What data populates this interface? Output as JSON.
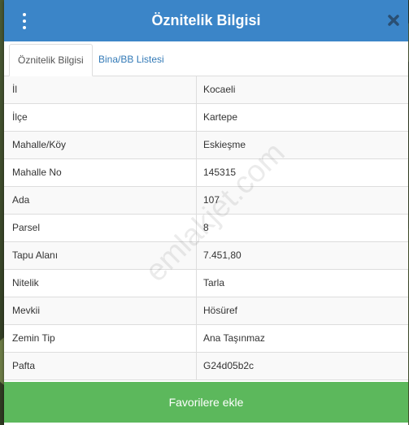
{
  "dialog": {
    "title": "Öznitelik Bilgisi",
    "menu_icon": "vertical-ellipsis-icon",
    "close_icon": "close-x-icon"
  },
  "tabs": [
    {
      "label": "Öznitelik Bilgisi",
      "active": true
    },
    {
      "label": "Bina/BB Listesi",
      "active": false
    }
  ],
  "attributes": [
    {
      "label": "İl",
      "value": "Kocaeli"
    },
    {
      "label": "İlçe",
      "value": "Kartepe"
    },
    {
      "label": "Mahalle/Köy",
      "value": "Eskieşme"
    },
    {
      "label": "Mahalle No",
      "value": "145315"
    },
    {
      "label": "Ada",
      "value": "107"
    },
    {
      "label": "Parsel",
      "value": "8"
    },
    {
      "label": "Tapu Alanı",
      "value": "7.451,80"
    },
    {
      "label": "Nitelik",
      "value": "Tarla"
    },
    {
      "label": "Mevkii",
      "value": "Hösüref"
    },
    {
      "label": "Zemin Tip",
      "value": "Ana Taşınmaz"
    },
    {
      "label": "Pafta",
      "value": "G24d05b2c"
    }
  ],
  "watermark": "emlakjet.com",
  "footer": {
    "favorite_button_label": "Favorilere ekle"
  },
  "colors": {
    "header": "#3b85c8",
    "accent_button": "#5cb85c",
    "tab_link": "#337ab7"
  }
}
